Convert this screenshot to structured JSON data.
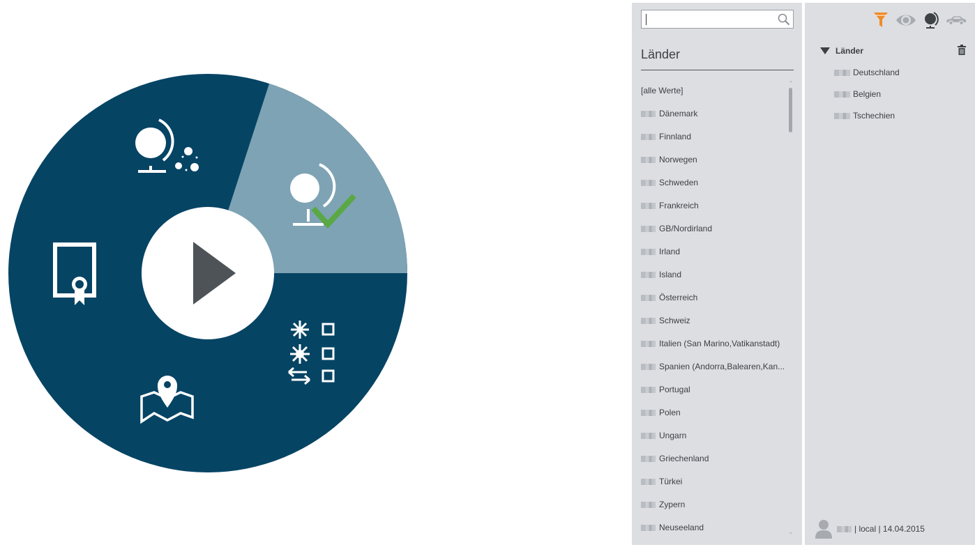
{
  "wheel": {
    "colors": {
      "segment": "#064464",
      "highlight": "#7ea3b4",
      "center": "#ffffff",
      "play": "#4d5356",
      "check": "#5aa845"
    },
    "segments": [
      {
        "name": "globe-multi",
        "icon": "globe-multi-icon"
      },
      {
        "name": "globe-check",
        "icon": "globe-check-icon",
        "selected": true
      },
      {
        "name": "filter-options",
        "icon": "options-list-icon"
      },
      {
        "name": "map",
        "icon": "map-pin-icon"
      },
      {
        "name": "certificate",
        "icon": "certificate-icon"
      }
    ],
    "center_icon": "play-icon"
  },
  "search": {
    "placeholder": "",
    "value": "",
    "icon": "search-icon"
  },
  "list": {
    "title": "Länder",
    "items": [
      "[alle Werte]",
      "Dänemark",
      "Finnland",
      "Norwegen",
      "Schweden",
      "Frankreich",
      "GB/Nordirland",
      "Irland",
      "Island",
      "Österreich",
      "Schweiz",
      "Italien (San Marino,Vatikanstadt)",
      "Spanien (Andorra,Balearen,Kan...",
      "Portugal",
      "Polen",
      "Ungarn",
      "Griechenland",
      "Türkei",
      "Zypern",
      "Neuseeland"
    ]
  },
  "toolbar": {
    "colors": {
      "filter": "#f08a24",
      "inactive": "#a7abb0",
      "globe": "#3d4245"
    },
    "buttons": [
      "filter-icon",
      "eye-icon",
      "globe-icon",
      "car-icon"
    ]
  },
  "selection": {
    "group_title": "Länder",
    "items": [
      "Deutschland",
      "Belgien",
      "Tschechien"
    ]
  },
  "footer": {
    "text": "| local | 14.04.2015"
  }
}
